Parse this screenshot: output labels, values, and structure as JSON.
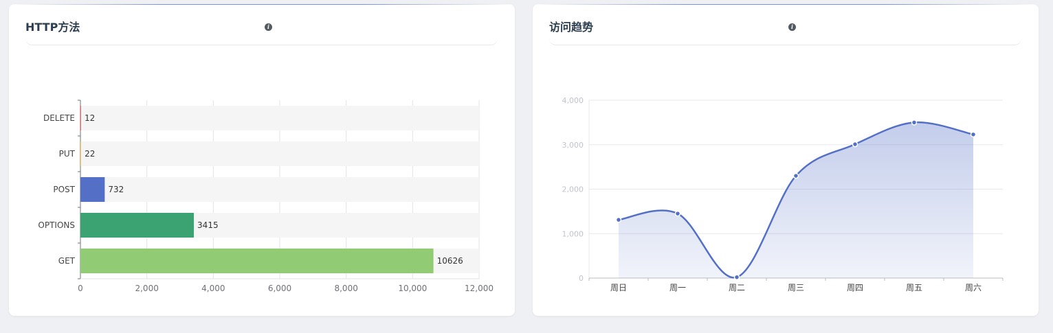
{
  "panels": [
    {
      "title": "HTTP方法",
      "info_icon": "info-icon"
    },
    {
      "title": "访问趋势",
      "info_icon": "info-icon"
    }
  ],
  "chart_data": [
    {
      "type": "bar",
      "orientation": "horizontal",
      "title": "HTTP方法",
      "categories": [
        "DELETE",
        "PUT",
        "POST",
        "OPTIONS",
        "GET"
      ],
      "values": [
        12,
        22,
        732,
        3415,
        10626
      ],
      "data_labels": [
        "12",
        "22",
        "732",
        "3415",
        "10626"
      ],
      "colors": [
        "#ee6666",
        "#fac858",
        "#5470c6",
        "#3ba272",
        "#91cc75"
      ],
      "xlim": [
        0,
        12000
      ],
      "x_ticks": [
        0,
        2000,
        4000,
        6000,
        8000,
        10000,
        12000
      ],
      "x_tick_labels": [
        "0",
        "2,000",
        "4,000",
        "6,000",
        "8,000",
        "10,000",
        "12,000"
      ],
      "show_background": true,
      "grid": true
    },
    {
      "type": "area",
      "smooth": true,
      "title": "访问趋势",
      "categories": [
        "周日",
        "周一",
        "周二",
        "周三",
        "周四",
        "周五",
        "周六"
      ],
      "values": [
        1310,
        1450,
        20,
        2300,
        3010,
        3500,
        3230
      ],
      "color": "#5470c6",
      "ylim": [
        0,
        4000
      ],
      "y_ticks": [
        0,
        1000,
        2000,
        3000,
        4000
      ],
      "y_tick_labels": [
        "0",
        "1,000",
        "2,000",
        "3,000",
        "4,000"
      ],
      "grid": true
    }
  ]
}
